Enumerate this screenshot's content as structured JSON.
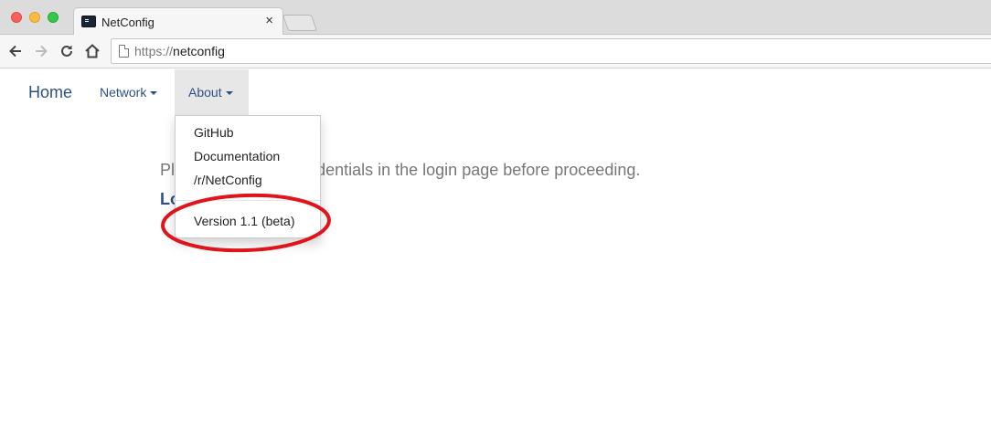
{
  "browser": {
    "tab_title": "NetConfig",
    "tab_close": "×",
    "url_scheme": "https://",
    "url_host": "netconfig"
  },
  "navbar": {
    "brand": "Home",
    "items": [
      {
        "label": "Network"
      },
      {
        "label": "About"
      }
    ]
  },
  "dropdown": {
    "items": [
      {
        "label": "GitHub"
      },
      {
        "label": "Documentation"
      },
      {
        "label": "/r/NetConfig"
      }
    ],
    "version": "Version 1.1 (beta)"
  },
  "main": {
    "message": "Please enter your credentials in the login page before proceeding.",
    "login_link": "Login"
  },
  "colors": {
    "link": "#2e5081",
    "annotation": "#e0141b"
  }
}
